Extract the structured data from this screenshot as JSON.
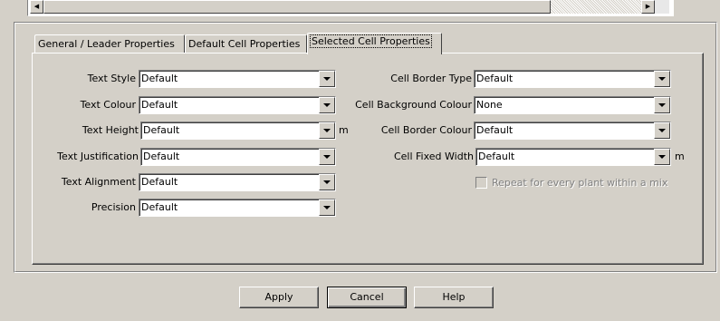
{
  "tabs": [
    {
      "label": "General / Leader Properties"
    },
    {
      "label": "Default Cell Properties"
    },
    {
      "label": "Selected Cell Properties"
    }
  ],
  "left": {
    "text_style": {
      "label": "Text Style",
      "value": "Default"
    },
    "text_colour": {
      "label": "Text Colour",
      "value": "Default"
    },
    "text_height": {
      "label": "Text Height",
      "value": "Default",
      "unit": "m"
    },
    "text_justification": {
      "label": "Text Justification",
      "value": "Default"
    },
    "text_alignment": {
      "label": "Text Alignment",
      "value": "Default"
    },
    "precision": {
      "label": "Precision",
      "value": "Default"
    }
  },
  "right": {
    "cell_border_type": {
      "label": "Cell Border Type",
      "value": "Default"
    },
    "cell_background_colour": {
      "label": "Cell Background Colour",
      "value": "None"
    },
    "cell_border_colour": {
      "label": "Cell Border Colour",
      "value": "Default"
    },
    "cell_fixed_width": {
      "label": "Cell Fixed Width",
      "value": "Default",
      "unit": "m"
    },
    "repeat_checkbox": {
      "label": "Repeat for every plant within a mix",
      "checked": false,
      "enabled": false
    }
  },
  "buttons": {
    "apply": "Apply",
    "cancel": "Cancel",
    "help": "Help"
  },
  "icons": {
    "scroll_left": "arrow-left-icon",
    "scroll_right": "arrow-right-icon",
    "dropdown": "chevron-down-icon"
  }
}
